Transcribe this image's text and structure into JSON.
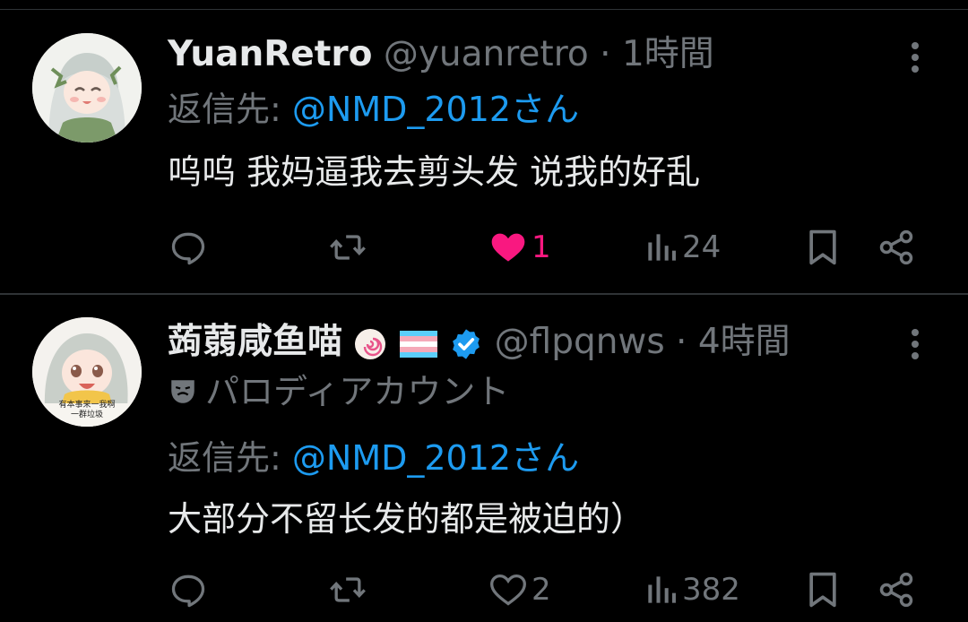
{
  "tweets": [
    {
      "display_name": "YuanRetro",
      "handle": "@yuanretro",
      "time": "1時間",
      "reply_prefix": "返信先:",
      "reply_to": "@NMD_2012さん",
      "text": "呜呜 我妈逼我去剪头发 说我的好乱",
      "likes": "1",
      "views": "24",
      "liked": true,
      "verified": false,
      "parody_label": ""
    },
    {
      "display_name": "蒟蒻咸鱼喵",
      "handle": "@flpqnws",
      "time": "4時間",
      "reply_prefix": "返信先:",
      "reply_to": "@NMD_2012さん",
      "text": "大部分不留长发的都是被迫的）",
      "likes": "2",
      "views": "382",
      "liked": false,
      "verified": true,
      "parody_label": "パロディアカウント",
      "avatar_caption_1": "有本事来一我啊",
      "avatar_caption_2": "一群垃圾"
    }
  ],
  "colors": {
    "background": "#000000",
    "text": "#e7e9ea",
    "secondary": "#71767b",
    "accent": "#1d9bf0",
    "like": "#f91880",
    "divider": "#2f3336"
  },
  "icons": {
    "reply": "reply-icon",
    "retweet": "retweet-icon",
    "like": "heart-icon",
    "views": "views-icon",
    "bookmark": "bookmark-icon",
    "share": "share-icon",
    "more": "more-icon",
    "parody": "theater-mask-icon"
  }
}
